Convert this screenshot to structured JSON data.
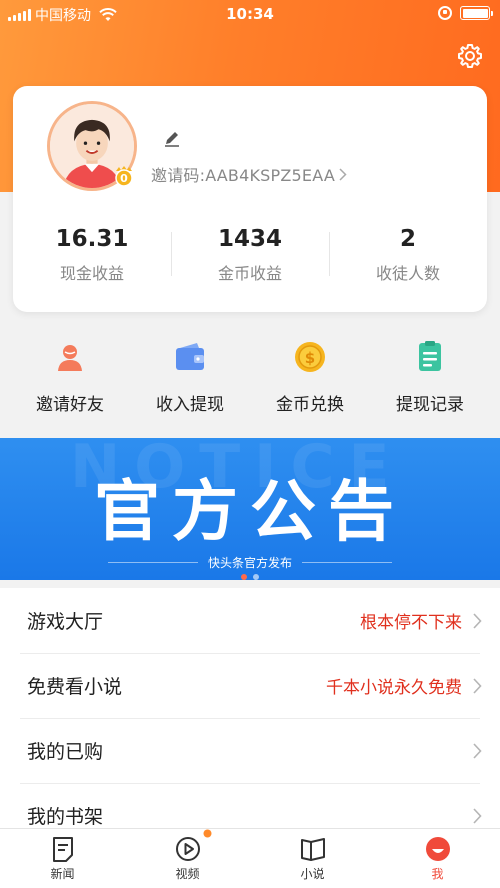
{
  "status_bar": {
    "carrier": "中国移动",
    "time": "10:34"
  },
  "profile": {
    "invite_code": "邀请码:AAB4KSPZ5EAA",
    "badge_level": "0",
    "stats": [
      {
        "value": "16.31",
        "label": "现金收益"
      },
      {
        "value": "1434",
        "label": "金币收益"
      },
      {
        "value": "2",
        "label": "收徒人数"
      }
    ]
  },
  "quick_actions": [
    {
      "label": "邀请好友",
      "icon": "invite-friend-icon",
      "color": "#f47b5b"
    },
    {
      "label": "收入提现",
      "icon": "wallet-icon",
      "color": "#5b8ff0"
    },
    {
      "label": "金币兑换",
      "icon": "gold-coin-icon",
      "color": "#f6b51f"
    },
    {
      "label": "提现记录",
      "icon": "record-icon",
      "color": "#3cc4a0"
    }
  ],
  "banner": {
    "title": "官方公告",
    "subtitle": "快头条官方发布",
    "watermark": "NOTICE",
    "active_slide": 1,
    "slide_count": 2
  },
  "menu": [
    {
      "label": "游戏大厅",
      "extra": "根本停不下来"
    },
    {
      "label": "免费看小说",
      "extra": "千本小说永久免费"
    },
    {
      "label": "我的已购",
      "extra": ""
    },
    {
      "label": "我的书架",
      "extra": ""
    }
  ],
  "tabs": [
    {
      "label": "新闻",
      "icon": "news-icon"
    },
    {
      "label": "视频",
      "icon": "video-icon"
    },
    {
      "label": "小说",
      "icon": "book-icon"
    },
    {
      "label": "我",
      "icon": "me-icon"
    }
  ],
  "colors": {
    "header_orange": "#ff7f2a",
    "accent_red": "#e0301e",
    "banner_blue": "#1a78e8",
    "active_tab": "#f04a3a"
  }
}
